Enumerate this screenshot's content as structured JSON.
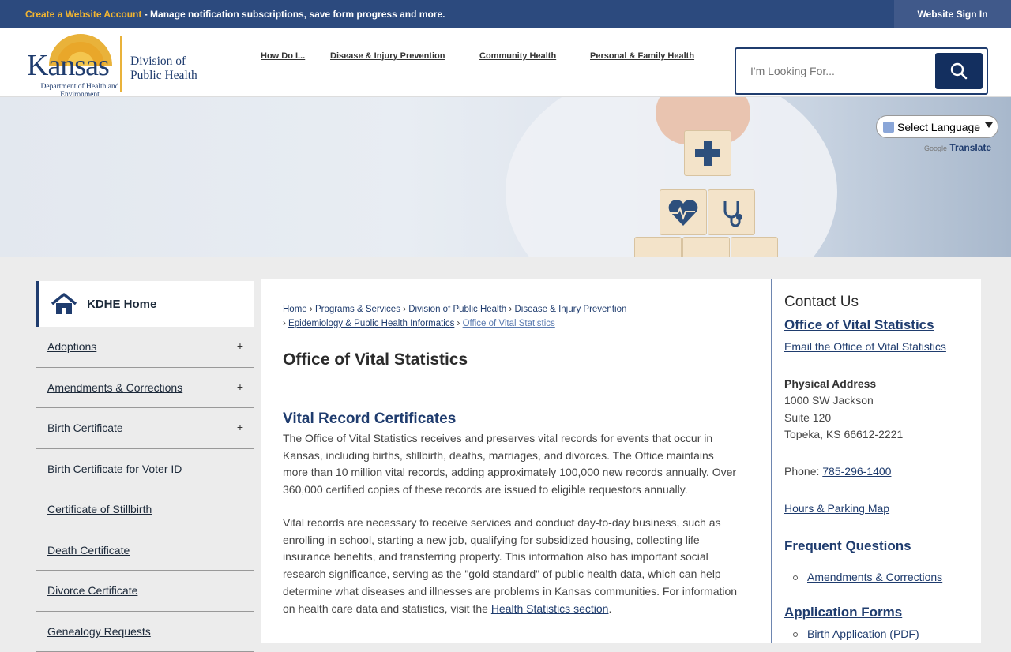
{
  "topbar": {
    "promo_link": "Create a Website Account",
    "promo_text": " - Manage notification subscriptions, save form progress and more.",
    "signin": "Website Sign In"
  },
  "header": {
    "logo_kansas": "Kansas",
    "logo_dept": "Department of Health and Environment",
    "logo_division_1": "Division of",
    "logo_division_2": "Public Health",
    "nav": [
      "How Do I...",
      "Disease & Injury Prevention",
      "Community Health",
      "Personal & Family Health"
    ],
    "search_placeholder": "I'm Looking For..."
  },
  "translate": {
    "select_label": "Select Language",
    "powered_by": "Google",
    "translate_link": "Translate"
  },
  "sidebar": {
    "home": "KDHE Home",
    "items": [
      {
        "label": "Adoptions",
        "expand": "+"
      },
      {
        "label": "Amendments & Corrections",
        "expand": "+"
      },
      {
        "label": "Birth Certificate",
        "expand": "+"
      },
      {
        "label": "Birth Certificate for Voter ID",
        "expand": ""
      },
      {
        "label": "Certificate of Stillbirth",
        "expand": ""
      },
      {
        "label": "Death Certificate",
        "expand": ""
      },
      {
        "label": "Divorce Certificate",
        "expand": ""
      },
      {
        "label": "Genealogy Requests",
        "expand": ""
      }
    ]
  },
  "breadcrumb": {
    "items": [
      "Home",
      "Programs & Services",
      "Division of Public Health",
      "Disease & Injury Prevention",
      "Epidemiology & Public Health Informatics"
    ],
    "current": "Office of Vital Statistics",
    "sep": "›"
  },
  "main": {
    "title": "Office of Vital Statistics",
    "section_title": "Vital Record Certificates",
    "para1": "The Office of Vital Statistics receives and preserves vital records for events that occur in Kansas, including births, stillbirth, deaths, marriages, and divorces. The Office maintains more than 10 million vital records, adding approximately 100,000 new records annually. Over 360,000 certified copies of these records are issued to eligible requestors annually.",
    "para2": "Vital records are necessary to receive services and conduct day-to-day business, such as enrolling in school, starting a new job, qualifying for subsidized housing, collecting life insurance benefits, and transferring property. This information also has important social research significance, serving as the \"gold standard\" of public health data, which can help determine what diseases and illnesses are problems in Kansas communities. For information on health care data and statistics, visit the ",
    "para2_link": "Health Statistics section",
    "para2_end": "."
  },
  "contact": {
    "heading": "Contact Us",
    "office": "Office of Vital Statistics",
    "email": "Email the Office of Vital Statistics",
    "address_label": "Physical Address",
    "address_1": "1000 SW Jackson",
    "address_2": "Suite 120",
    "address_3": "Topeka, KS 66612-2221",
    "phone_label": "Phone: ",
    "phone": "785-296-1400",
    "hours": "Hours & Parking Map",
    "faq_heading": "Frequent Questions",
    "faq_item": "Amendments & Corrections",
    "forms_heading": "Application Forms",
    "forms_item": "Birth Application (PDF)"
  },
  "colors": {
    "brand_navy": "#1f3c6e",
    "topbar": "#2c4a7e",
    "accent_gold": "#f2b531"
  }
}
